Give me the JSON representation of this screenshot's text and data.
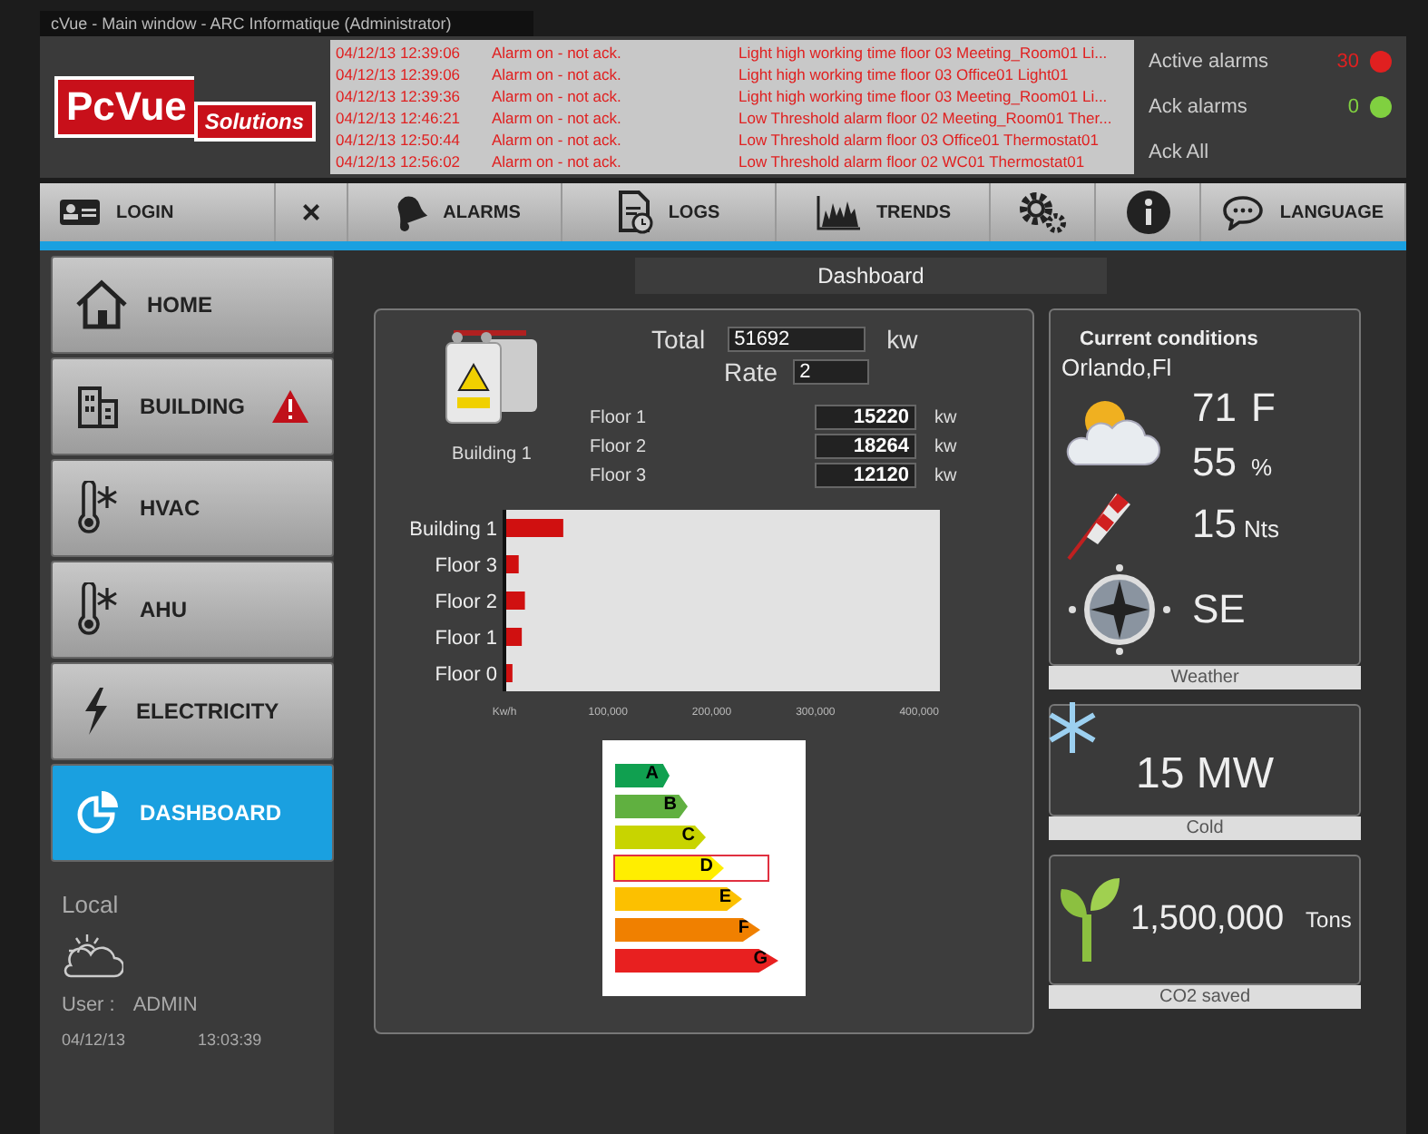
{
  "window": {
    "title": "cVue - Main window - ARC Informatique (Administrator)"
  },
  "logo": {
    "brand": "PcVue",
    "tagline": "Solutions"
  },
  "alarm_log": [
    {
      "timestamp": "04/12/13 12:39:06",
      "status": "Alarm on - not ack.",
      "message": "Light high working time floor 03 Meeting_Room01 Li..."
    },
    {
      "timestamp": "04/12/13 12:39:06",
      "status": "Alarm on - not ack.",
      "message": "Light high working time floor 03 Office01 Light01"
    },
    {
      "timestamp": "04/12/13 12:39:36",
      "status": "Alarm on - not ack.",
      "message": "Light high working time floor 03 Meeting_Room01 Li..."
    },
    {
      "timestamp": "04/12/13 12:46:21",
      "status": "Alarm on - not ack.",
      "message": "Low Threshold alarm floor 02 Meeting_Room01 Ther..."
    },
    {
      "timestamp": "04/12/13 12:50:44",
      "status": "Alarm on - not ack.",
      "message": "Low Threshold alarm floor 03 Office01 Thermostat01"
    },
    {
      "timestamp": "04/12/13 12:56:02",
      "status": "Alarm on - not ack.",
      "message": "Low Threshold alarm floor 02 WC01 Thermostat01"
    }
  ],
  "alarm_summary": [
    {
      "label": "Active alarms",
      "count": "30",
      "color": "#e02020"
    },
    {
      "label": "Ack alarms",
      "count": "0",
      "color": "#80d040"
    },
    {
      "label": "Ack All"
    }
  ],
  "toolbar": [
    {
      "kind": "login",
      "label": "LOGIN"
    },
    {
      "kind": "close",
      "label": "×"
    },
    {
      "kind": "alarms",
      "label": "ALARMS"
    },
    {
      "kind": "logs",
      "label": "LOGS"
    },
    {
      "kind": "trends",
      "label": "TRENDS"
    },
    {
      "kind": "settings"
    },
    {
      "kind": "info"
    },
    {
      "kind": "language",
      "label": "LANGUAGE"
    }
  ],
  "sidebar": {
    "items": [
      {
        "kind": "home",
        "label": "HOME",
        "selected": false,
        "alert": false
      },
      {
        "kind": "building",
        "label": "BUILDING",
        "selected": false,
        "alert": true
      },
      {
        "kind": "hvac",
        "label": "HVAC",
        "selected": false,
        "alert": false
      },
      {
        "kind": "hvac",
        "label": "AHU",
        "selected": false,
        "alert": false
      },
      {
        "kind": "electricity",
        "label": "ELECTRICITY",
        "selected": false,
        "alert": false
      },
      {
        "kind": "dashboard",
        "label": "DASHBOARD",
        "selected": true,
        "alert": false
      }
    ],
    "location": "Local",
    "user_label": "User :",
    "user": "ADMIN",
    "date": "04/12/13",
    "time": "13:03:39"
  },
  "page_title": "Dashboard",
  "building": {
    "name": "Building 1",
    "total_label": "Total",
    "total": "51692",
    "total_unit": "kw",
    "rate_label": "Rate",
    "rate": "2",
    "floors": [
      {
        "name": "Floor 1",
        "value": "15220",
        "unit": "kw"
      },
      {
        "name": "Floor 2",
        "value": "18264",
        "unit": "kw"
      },
      {
        "name": "Floor 3",
        "value": "12120",
        "unit": "kw"
      }
    ],
    "chart_data": {
      "type": "bar",
      "orientation": "horizontal",
      "categories": [
        "Building 1",
        "Floor 3",
        "Floor 2",
        "Floor 1",
        "Floor 0"
      ],
      "series": [
        {
          "color": "#d01010",
          "values": [
            55000,
            12000,
            18000,
            15000,
            6000
          ]
        }
      ],
      "xlim": [
        0,
        420000
      ],
      "xticks": [
        {
          "value": 0,
          "label": "Kw/h"
        },
        {
          "value": 100000,
          "label": "100,000"
        },
        {
          "value": 200000,
          "label": "200,000"
        },
        {
          "value": 300000,
          "label": "300,000"
        },
        {
          "value": 400000,
          "label": "400,000"
        }
      ]
    },
    "energy_classes": [
      {
        "letter": "A",
        "color": "#10a050",
        "selected": false
      },
      {
        "letter": "B",
        "color": "#60b040",
        "selected": false
      },
      {
        "letter": "C",
        "color": "#c8d400",
        "selected": false
      },
      {
        "letter": "D",
        "color": "#ffee00",
        "selected": true
      },
      {
        "letter": "E",
        "color": "#fcc000",
        "selected": false
      },
      {
        "letter": "F",
        "color": "#f08000",
        "selected": false
      },
      {
        "letter": "G",
        "color": "#e82020",
        "selected": false
      }
    ]
  },
  "weather": {
    "title": "Current conditions",
    "city": "Orlando,Fl",
    "temperature": "71",
    "temperature_unit": "F",
    "humidity": "55",
    "humidity_unit": "%",
    "wind_speed": "15",
    "wind_unit": "Nts",
    "wind_direction": "SE",
    "caption": "Weather"
  },
  "cold": {
    "value": "15 MW",
    "caption": "Cold"
  },
  "co2": {
    "value": "1,500,000",
    "unit": "Tons",
    "caption": "CO2  saved"
  }
}
